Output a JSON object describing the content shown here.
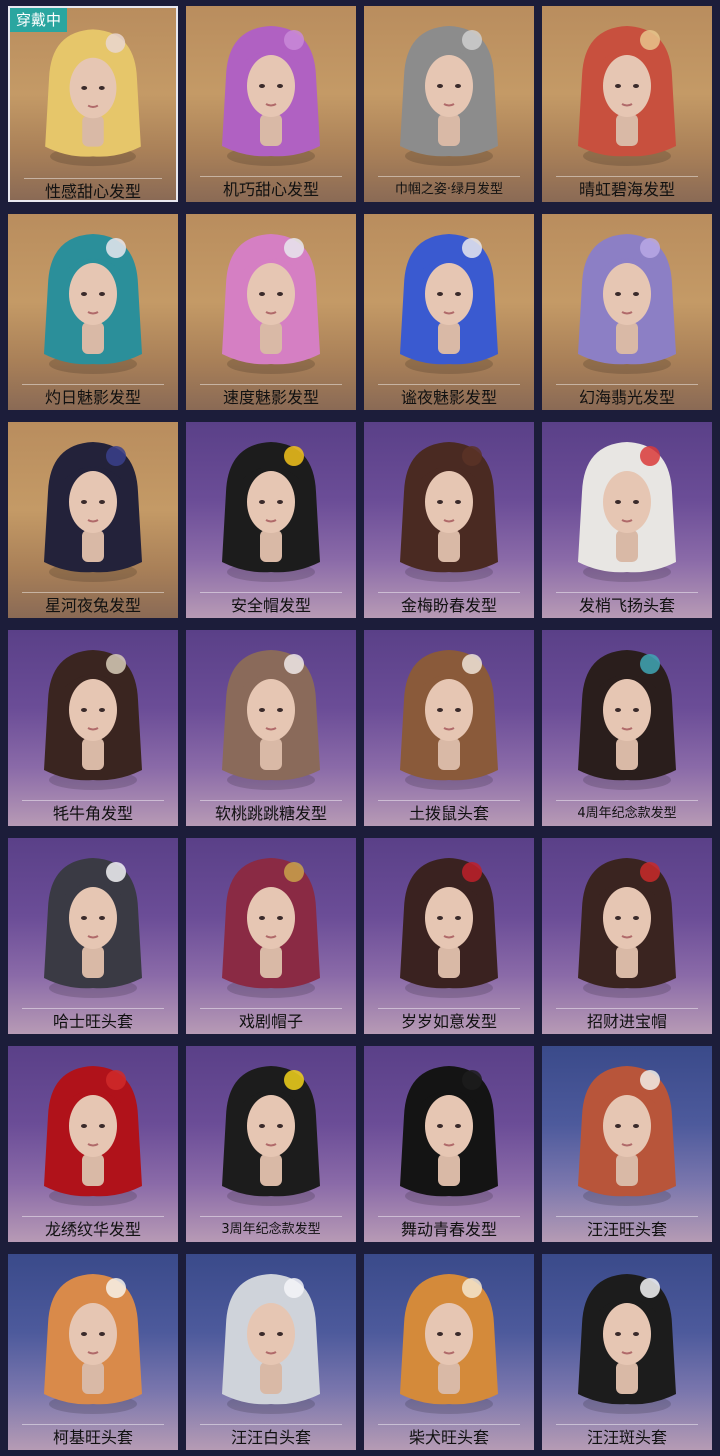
{
  "badge": "穿戴中",
  "items": [
    {
      "label": "性感甜心发型",
      "bg": "orange",
      "hair": "#e6c66a",
      "acc": "#e9d6d0"
    },
    {
      "label": "机巧甜心发型",
      "bg": "orange",
      "hair": "#b061c2",
      "acc": "#c98ad8"
    },
    {
      "label": "巾帼之姿·绿月发型",
      "bg": "orange",
      "hair": "#8c8c8c",
      "acc": "#cfcfcf"
    },
    {
      "label": "晴虹碧海发型",
      "bg": "orange",
      "hair": "#c8503e",
      "acc": "#e7c48c"
    },
    {
      "label": "灼日魅影发型",
      "bg": "orange",
      "hair": "#2b8f9a",
      "acc": "#e8e8ee"
    },
    {
      "label": "速度魅影发型",
      "bg": "orange",
      "hair": "#d57fc3",
      "acc": "#e8e8ee"
    },
    {
      "label": "谧夜魅影发型",
      "bg": "orange",
      "hair": "#3a5ad0",
      "acc": "#e8e8ee"
    },
    {
      "label": "幻海翡光发型",
      "bg": "orange",
      "hair": "#8c7fc5",
      "acc": "#b9a8e5"
    },
    {
      "label": "星河夜兔发型",
      "bg": "orange",
      "hair": "#23223a",
      "acc": "#3a3f8c"
    },
    {
      "label": "安全帽发型",
      "bg": "purple",
      "hair": "#1c1c1c",
      "acc": "#f2c21b"
    },
    {
      "label": "金梅盼春发型",
      "bg": "purple",
      "hair": "#4a2a22",
      "acc": "#5a3326"
    },
    {
      "label": "发梢飞扬头套",
      "bg": "purple",
      "hair": "#e8e6e3",
      "acc": "#d93a3a"
    },
    {
      "label": "牦牛角发型",
      "bg": "purple",
      "hair": "#3a2520",
      "acc": "#d8cdb8"
    },
    {
      "label": "软桃跳跳糖发型",
      "bg": "purple",
      "hair": "#8a6a5a",
      "acc": "#efe7e8"
    },
    {
      "label": "土拨鼠头套",
      "bg": "purple",
      "hair": "#8a5a3a",
      "acc": "#efe4d8"
    },
    {
      "label": "4周年纪念款发型",
      "bg": "purple",
      "hair": "#2a1e1c",
      "acc": "#3fa7b5"
    },
    {
      "label": "哈士旺头套",
      "bg": "purple",
      "hair": "#3a3a44",
      "acc": "#f2f2f4"
    },
    {
      "label": "戏剧帽子",
      "bg": "purple",
      "hair": "#8a2a44",
      "acc": "#c9a24a"
    },
    {
      "label": "岁岁如意发型",
      "bg": "purple",
      "hair": "#3a2220",
      "acc": "#c0202a"
    },
    {
      "label": "招财进宝帽",
      "bg": "purple",
      "hair": "#3a2420",
      "acc": "#c92a2a"
    },
    {
      "label": "龙绣纹华发型",
      "bg": "purple",
      "hair": "#b0121a",
      "acc": "#d02a2a"
    },
    {
      "label": "3周年纪念款发型",
      "bg": "purple",
      "hair": "#1c1c1c",
      "acc": "#f2d21b"
    },
    {
      "label": "舞动青春发型",
      "bg": "purple",
      "hair": "#141414",
      "acc": "#1c1c1c"
    },
    {
      "label": "汪汪旺头套",
      "bg": "blue",
      "hair": "#b8553a",
      "acc": "#f2efe8"
    },
    {
      "label": "柯基旺头套",
      "bg": "blue",
      "hair": "#d98a4a",
      "acc": "#f7f2ea"
    },
    {
      "label": "汪汪白头套",
      "bg": "blue",
      "hair": "#cfd3da",
      "acc": "#f4f5f8"
    },
    {
      "label": "柴犬旺头套",
      "bg": "blue",
      "hair": "#d48a3a",
      "acc": "#f4e6cf"
    },
    {
      "label": "汪汪斑头套",
      "bg": "blue",
      "hair": "#1c1c1c",
      "acc": "#f4f4f6"
    }
  ]
}
